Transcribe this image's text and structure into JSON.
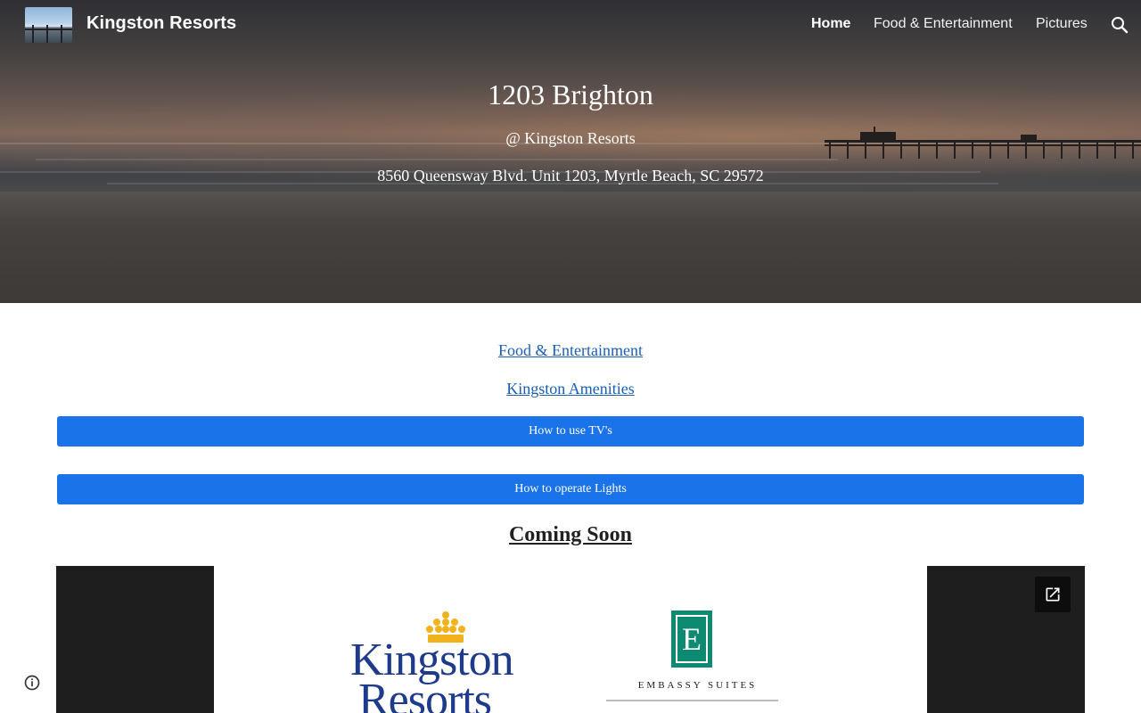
{
  "header": {
    "site_title": "Kingston Resorts",
    "nav": [
      {
        "label": "Home",
        "active": true
      },
      {
        "label": "Food & Entertainment",
        "active": false
      },
      {
        "label": "Pictures",
        "active": false
      }
    ],
    "search_icon": "search-icon"
  },
  "hero": {
    "title": "1203 Brighton",
    "subtitle": "@ Kingston Resorts",
    "address": "8560 Queensway Blvd. Unit 1203, Myrtle Beach, SC 29572"
  },
  "content": {
    "links": [
      "Food & Entertainment",
      "Kingston Amenities"
    ],
    "buttons": [
      "How to use TV's",
      "How to operate Lights"
    ],
    "coming_soon": "Coming Soon",
    "embed": {
      "open_icon": "open-in-new-icon",
      "logos": {
        "kingston_line1": "Kingston",
        "kingston_line2": "Resorts",
        "embassy_letter": "E",
        "embassy_name": "EMBASSY SUITES"
      }
    }
  },
  "footer": {
    "info_icon": "info-icon"
  },
  "colors": {
    "button_blue": "#1a73e8",
    "link_blue": "#1a5fb4",
    "kingston_navy": "#1e3a8a",
    "embassy_green": "#0e8a73",
    "crown_gold": "#f2b21b"
  }
}
